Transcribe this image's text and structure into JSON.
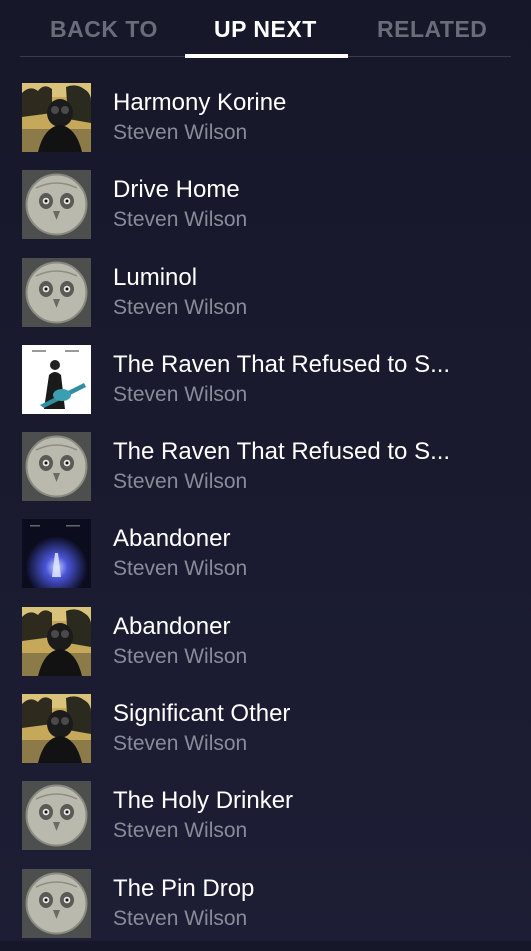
{
  "tabs": [
    {
      "label": "BACK TO",
      "active": false
    },
    {
      "label": "UP NEXT",
      "active": true
    },
    {
      "label": "RELATED",
      "active": false
    }
  ],
  "colors": {
    "active_tab": "#ffffff",
    "inactive_tab": "#6b6c7a",
    "artist_text": "#8a8b98",
    "background": "#17172a"
  },
  "queue": [
    {
      "title": "Harmony Korine",
      "artist": "Steven Wilson",
      "art": "insurgentes-cover"
    },
    {
      "title": "Drive Home",
      "artist": "Steven Wilson",
      "art": "raven-cover"
    },
    {
      "title": "Luminol",
      "artist": "Steven Wilson",
      "art": "raven-cover"
    },
    {
      "title": "The Raven That Refused to S...",
      "artist": "Steven Wilson",
      "art": "white-guitar-cover"
    },
    {
      "title": "The Raven That Refused to S...",
      "artist": "Steven Wilson",
      "art": "raven-cover"
    },
    {
      "title": "Abandoner",
      "artist": "Steven Wilson",
      "art": "blue-light-cover"
    },
    {
      "title": "Abandoner",
      "artist": "Steven Wilson",
      "art": "insurgentes-cover"
    },
    {
      "title": "Significant Other",
      "artist": "Steven Wilson",
      "art": "insurgentes-cover"
    },
    {
      "title": "The Holy Drinker",
      "artist": "Steven Wilson",
      "art": "raven-cover"
    },
    {
      "title": "The Pin Drop",
      "artist": "Steven Wilson",
      "art": "raven-cover"
    }
  ]
}
